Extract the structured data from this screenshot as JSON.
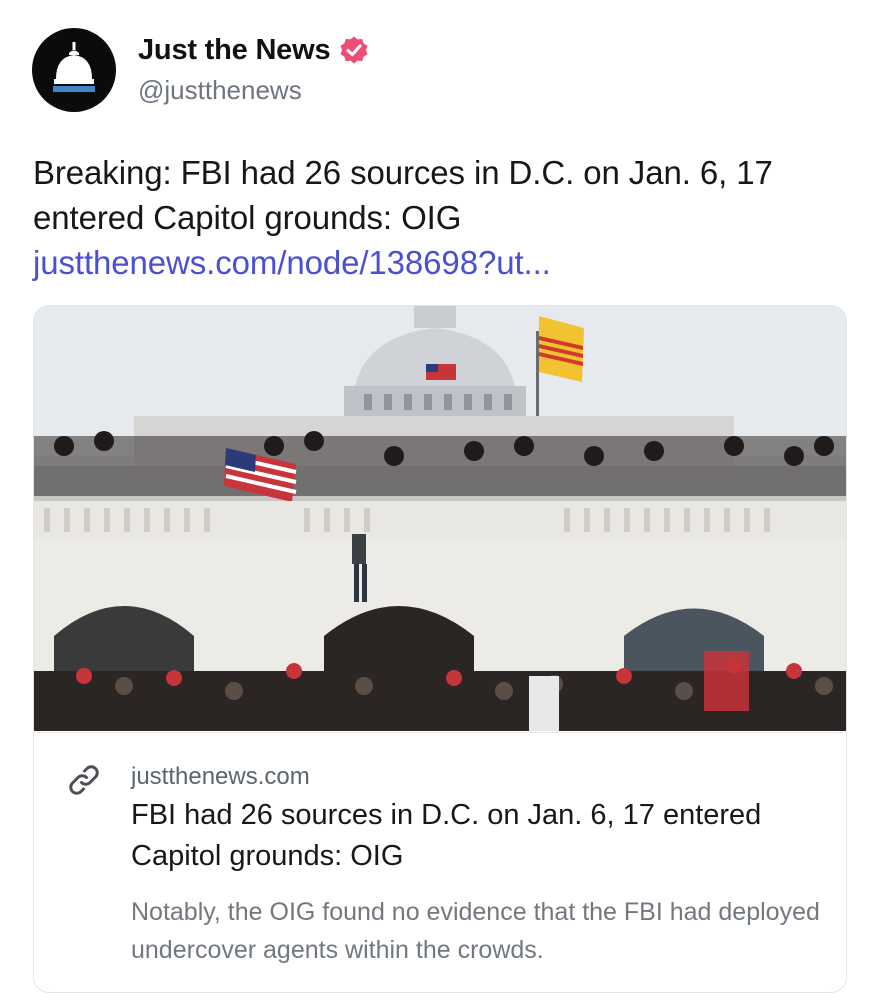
{
  "author": {
    "display_name": "Just the News",
    "handle": "@justthenews",
    "avatar_icon": "capitol-dome-icon",
    "verified_icon": "verified-badge-icon",
    "verified_color": "#ee4e76"
  },
  "post": {
    "text": "Breaking: FBI had 26 sources in D.C. on Jan. 6, 17 entered Capitol grounds: OIG ",
    "link_text": "justthenews.com/node/138698?ut...",
    "link_color": "#4a4fd4"
  },
  "card": {
    "image_alt": "Crowd on the U.S. Capitol steps with flags",
    "link_icon": "link-icon",
    "domain": "justthenews.com",
    "title": "FBI had 26 sources in D.C. on Jan. 6, 17 entered Capitol grounds: OIG",
    "description": "Notably, the OIG found no evidence that the FBI had deployed undercover agents within the crowds."
  }
}
